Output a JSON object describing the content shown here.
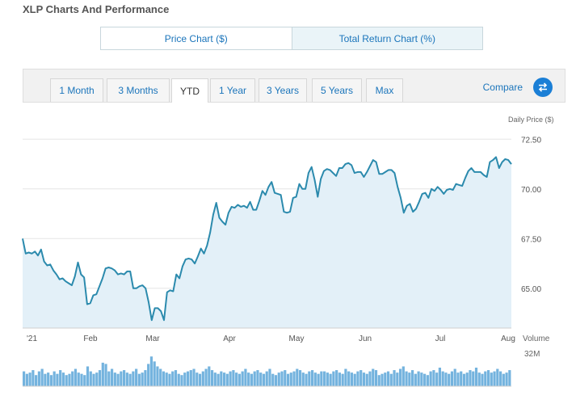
{
  "header": {
    "title": "XLP Charts And Performance"
  },
  "chart_toggle": {
    "price_label": "Price Chart ($)",
    "total_return_label": "Total Return Chart (%)"
  },
  "range_tabs": [
    "1 Month",
    "3 Months",
    "YTD",
    "1 Year",
    "3 Years",
    "5 Years",
    "Max"
  ],
  "active_range": "YTD",
  "compare_label": "Compare",
  "colors": {
    "line": "#2b8aad",
    "area": "#e3f0f8",
    "volume": "#74b3de",
    "link": "#1b75bb",
    "compare_button": "#1b7fd6"
  },
  "icons": {
    "compare": "swap-arrows-icon"
  },
  "chart_data": {
    "type": "line",
    "ylabel": "Daily Price ($)",
    "yticks": [
      "72.50",
      "70.00",
      "67.50",
      "65.00"
    ],
    "ylim": [
      63.0,
      73.0
    ],
    "xticks": [
      "'21",
      "Feb",
      "Mar",
      "Apr",
      "May",
      "Jun",
      "Jul",
      "Aug"
    ],
    "grid": true,
    "prices": [
      67.5,
      66.75,
      66.8,
      66.75,
      66.85,
      66.65,
      66.95,
      66.35,
      66.15,
      66.2,
      65.9,
      65.7,
      65.45,
      65.5,
      65.35,
      65.25,
      65.15,
      65.6,
      66.3,
      65.7,
      65.55,
      64.2,
      64.25,
      64.65,
      64.7,
      65.1,
      65.5,
      66.0,
      66.05,
      66.0,
      65.9,
      65.7,
      65.75,
      65.7,
      65.85,
      65.85,
      65.0,
      65.0,
      65.1,
      65.15,
      65.0,
      64.3,
      63.4,
      64.0,
      64.0,
      63.85,
      63.4,
      64.8,
      64.9,
      64.85,
      65.7,
      65.5,
      66.1,
      66.45,
      66.5,
      66.45,
      66.25,
      66.6,
      67.0,
      66.75,
      67.15,
      67.8,
      68.7,
      69.3,
      68.55,
      68.35,
      68.2,
      68.8,
      69.1,
      69.05,
      69.2,
      69.1,
      69.15,
      69.05,
      69.35,
      68.95,
      68.95,
      69.4,
      69.9,
      69.7,
      70.1,
      70.35,
      69.8,
      69.75,
      69.7,
      68.85,
      68.8,
      68.85,
      69.55,
      69.6,
      70.25,
      70.0,
      70.0,
      70.8,
      71.1,
      70.45,
      69.6,
      70.5,
      70.9,
      71.0,
      70.95,
      70.8,
      70.65,
      71.05,
      71.05,
      71.25,
      71.3,
      71.2,
      70.8,
      70.85,
      70.85,
      70.6,
      70.85,
      71.15,
      71.45,
      71.35,
      70.75,
      70.75,
      70.85,
      70.95,
      70.95,
      70.8,
      70.1,
      69.55,
      68.8,
      69.15,
      69.25,
      68.85,
      69.0,
      69.35,
      69.75,
      69.8,
      69.55,
      70.0,
      69.9,
      70.1,
      69.95,
      69.75,
      69.95,
      70.0,
      69.95,
      70.25,
      70.2,
      70.15,
      70.55,
      70.9,
      71.05,
      70.85,
      70.85,
      70.85,
      70.7,
      70.6,
      71.35,
      71.45,
      71.6,
      71.05,
      71.35,
      71.5,
      71.45,
      71.25
    ]
  },
  "volume": {
    "label": "Volume",
    "max_label": "32M",
    "bars": [
      12,
      10,
      11,
      13,
      9,
      12,
      14,
      10,
      11,
      9,
      12,
      10,
      13,
      11,
      9,
      10,
      12,
      14,
      11,
      10,
      9,
      16,
      12,
      10,
      11,
      13,
      19,
      18,
      12,
      14,
      11,
      10,
      12,
      13,
      11,
      10,
      12,
      14,
      10,
      11,
      13,
      18,
      24,
      20,
      16,
      14,
      12,
      11,
      10,
      12,
      13,
      10,
      9,
      11,
      12,
      13,
      14,
      11,
      10,
      12,
      14,
      16,
      13,
      11,
      10,
      12,
      11,
      10,
      12,
      13,
      11,
      10,
      12,
      14,
      11,
      10,
      12,
      13,
      11,
      10,
      12,
      14,
      10,
      9,
      11,
      12,
      13,
      10,
      11,
      12,
      14,
      13,
      11,
      10,
      12,
      13,
      11,
      10,
      12,
      12,
      11,
      10,
      12,
      13,
      11,
      10,
      14,
      12,
      11,
      10,
      12,
      13,
      11,
      10,
      12,
      14,
      13,
      9,
      10,
      11,
      12,
      10,
      13,
      11,
      14,
      16,
      12,
      11,
      13,
      10,
      12,
      11,
      10,
      9,
      12,
      13,
      11,
      15,
      12,
      11,
      10,
      12,
      14,
      11,
      12,
      10,
      11,
      13,
      12,
      15,
      11,
      10,
      12,
      13,
      11,
      12,
      14,
      12,
      10,
      11,
      13
    ]
  }
}
